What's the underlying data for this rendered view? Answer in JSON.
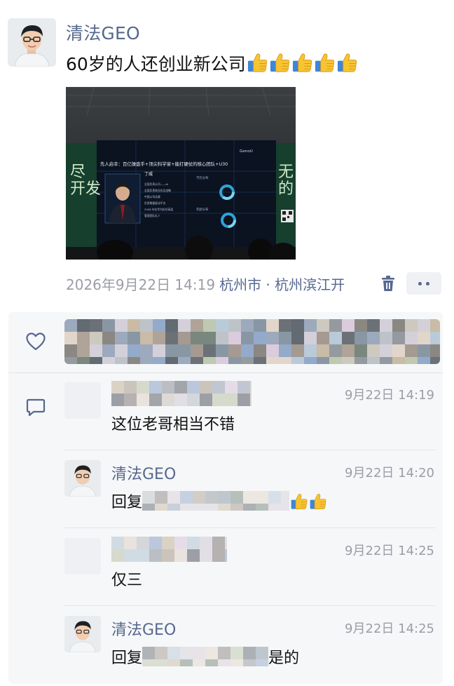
{
  "post": {
    "author_name": "清法GEO",
    "text": "60岁的人还创业新公司",
    "thumbs_count": 5,
    "photo": {
      "slide_title": "先人启幸：百亿操盘手+顶尖科学家+能打硬仗的核心团队+U30",
      "speaker_name": "丁威",
      "left_banner": "尽\n开发",
      "right_banner": "无\n的",
      "right_logo": "GenoU",
      "chart_label_1": "学历分布",
      "chart_label_2": "年龄分布",
      "list_items": [
        "全面负责公司——AI",
        "全面负责商业化及战略",
        "中国公司总裁",
        "负责数据驱动平台",
        "2008 年在华为担任高层",
        "管理团队队人"
      ]
    },
    "date": "2026年9月22日 14:19",
    "location": "杭州市 · 杭州滨江开",
    "colors": {
      "name_blue": "#56688f",
      "meta_gray": "#9a9ea5",
      "panel_bg": "#f6f7f8"
    }
  },
  "icons": {
    "trash": "trash-icon",
    "more": "more-icon",
    "heart": "heart-icon",
    "comment": "comment-icon",
    "thumb": "thumbs-up-emoji"
  },
  "comments": [
    {
      "name": "",
      "time": "9月22日 14:19",
      "text": "这位老哥相当不错",
      "name_hidden": true
    },
    {
      "name": "清法GEO",
      "time": "9月22日 14:20",
      "reply_prefix": "回复",
      "reply_suffix": "",
      "thumbs_count": 2
    },
    {
      "name": "",
      "time": "9月22日 14:25",
      "text": "仅三",
      "name_hidden": true
    },
    {
      "name": "清法GEO",
      "time": "9月22日 14:25",
      "reply_prefix": "回复",
      "reply_suffix": "是的"
    }
  ]
}
